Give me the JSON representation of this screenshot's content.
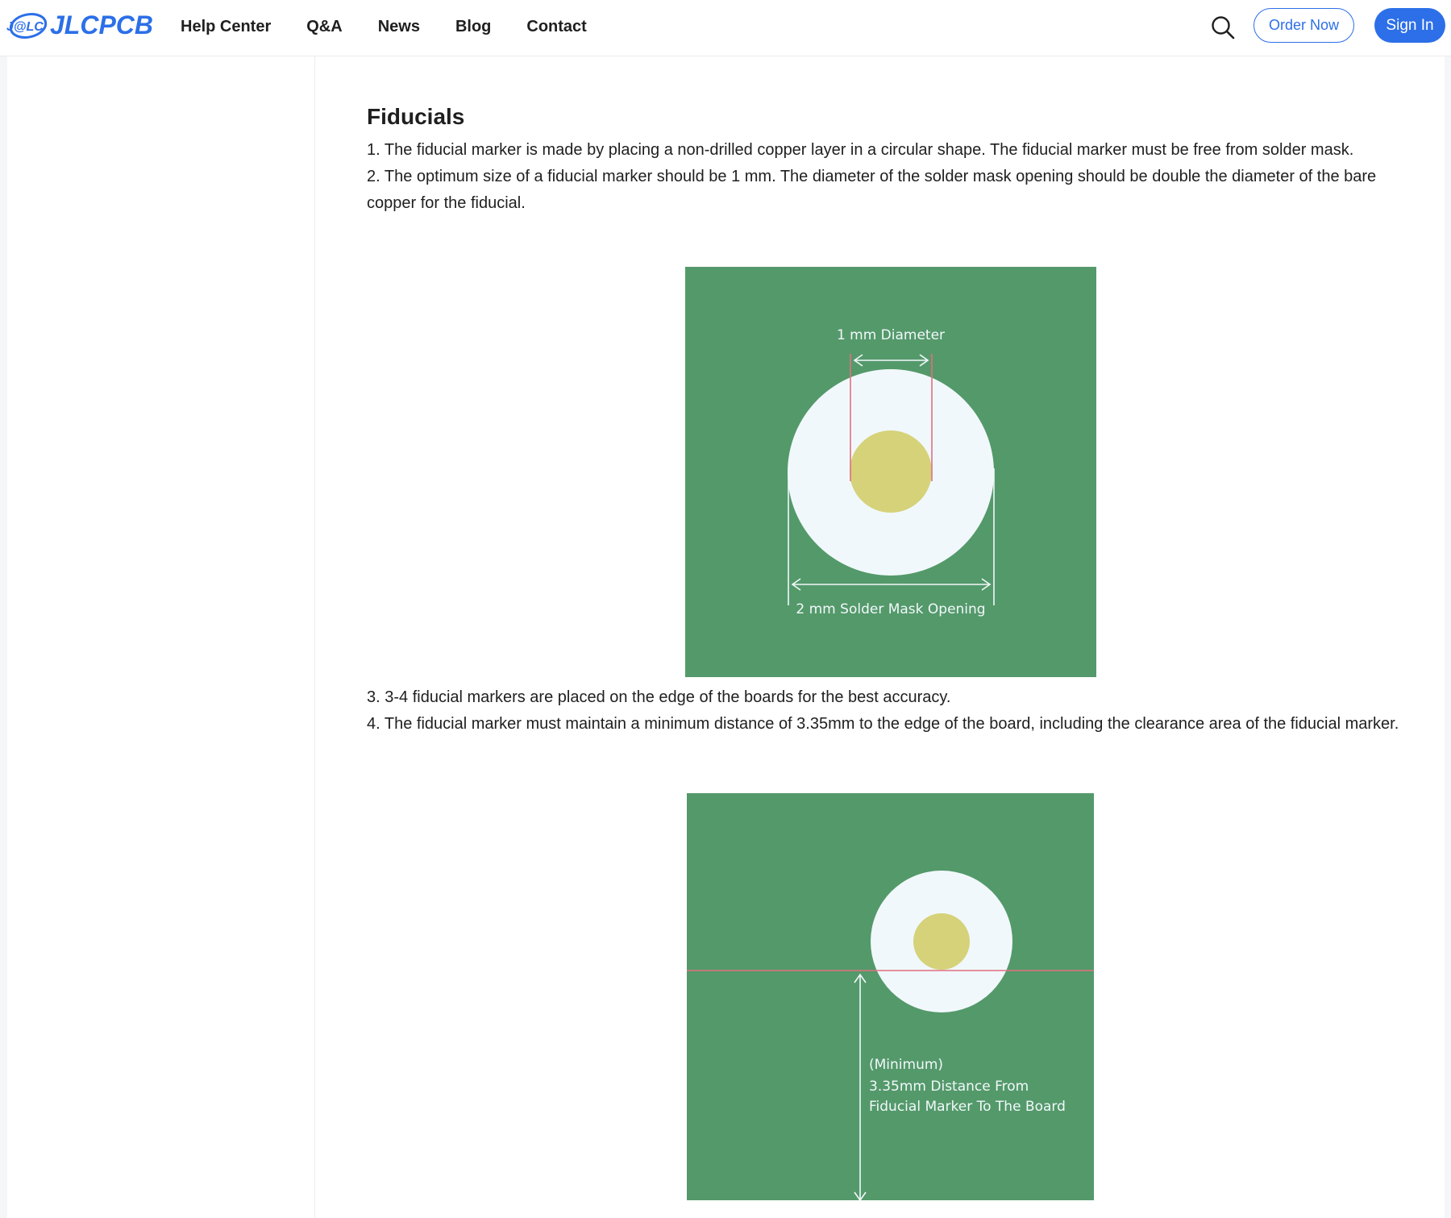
{
  "header": {
    "logo_mark": "J@LC",
    "logo_text": "JLCPCB",
    "nav": [
      "Help Center",
      "Q&A",
      "News",
      "Blog",
      "Contact"
    ],
    "search_icon": "search-icon",
    "order_label": "Order Now",
    "signin_label": "Sign In"
  },
  "colors": {
    "brand_blue": "#2c6fe8",
    "pcb_green": "#54996a",
    "solder_mask_opening": "#f1f8fb",
    "copper": "#d5d27a",
    "guide_line": "#e07080"
  },
  "article": {
    "title": "Fiducials",
    "p1": "1. The fiducial marker is made by placing a non-drilled copper layer in a circular shape. The fiducial marker must be free from solder mask.",
    "p2": "2. The optimum size of a fiducial marker should be 1 mm. The diameter of the solder mask opening should be double the diameter of the bare copper for the fiducial.",
    "p3": "3. 3-4 fiducial markers are placed on the edge of the boards for the best accuracy.",
    "p4": "4. The fiducial marker must maintain a minimum distance of 3.35mm to the edge of the board, including the clearance area of the fiducial marker."
  },
  "figure1": {
    "top_label": "1 mm  Diameter",
    "bottom_label": "2 mm Solder Mask Opening"
  },
  "figure2": {
    "label_line1": "(Minimum)",
    "label_line2": "3.35mm Distance From",
    "label_line3": "Fiducial Marker To The Board"
  }
}
